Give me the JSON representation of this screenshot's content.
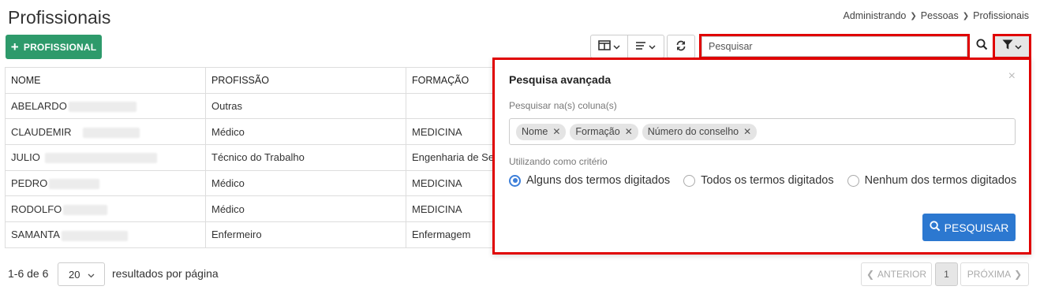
{
  "page": {
    "title": "Profissionais",
    "breadcrumb": [
      "Administrando",
      "Pessoas",
      "Profissionais"
    ]
  },
  "toolbar": {
    "add_label": "PROFISSIONAL",
    "search_placeholder": "Pesquisar",
    "icons": [
      "columns-icon",
      "list-icon",
      "refresh-icon",
      "search-icon",
      "filter-icon"
    ]
  },
  "table": {
    "columns": [
      "NOME",
      "PROFISSÃO",
      "FORMAÇÃO"
    ],
    "rows": [
      {
        "nome": "ABELARDO",
        "profissao": "Outras",
        "formacao": ""
      },
      {
        "nome": "CLAUDEMIR",
        "profissao": "Médico",
        "formacao": "MEDICINA"
      },
      {
        "nome": "JULIO",
        "profissao": "Técnico do Trabalho",
        "formacao": "Engenharia de Se"
      },
      {
        "nome": "PEDRO",
        "profissao": "Médico",
        "formacao": "MEDICINA"
      },
      {
        "nome": "RODOLFO",
        "profissao": "Médico",
        "formacao": "MEDICINA"
      },
      {
        "nome": "SAMANTA",
        "profissao": "Enfermeiro",
        "formacao": "Enfermagem"
      }
    ]
  },
  "pagination": {
    "info": "1-6 de 6",
    "page_size": "20",
    "page_size_label": "resultados por página",
    "prev_label": "ANTERIOR",
    "current_page": "1",
    "next_label": "PRÓXIMA"
  },
  "advanced_search": {
    "title": "Pesquisa avançada",
    "close": "×",
    "columns_label": "Pesquisar na(s) coluna(s)",
    "tags": [
      "Nome",
      "Formação",
      "Número do conselho"
    ],
    "criteria_label": "Utilizando como critério",
    "criteria_options": [
      "Alguns dos termos digitados",
      "Todos os termos digitados",
      "Nenhum dos termos digitados"
    ],
    "selected_criteria": "Alguns dos termos digitados",
    "submit_label": "PESQUISAR"
  },
  "colors": {
    "primary_green": "#2e9a6b",
    "primary_blue": "#2c78d0",
    "highlight_red": "#e00000"
  }
}
